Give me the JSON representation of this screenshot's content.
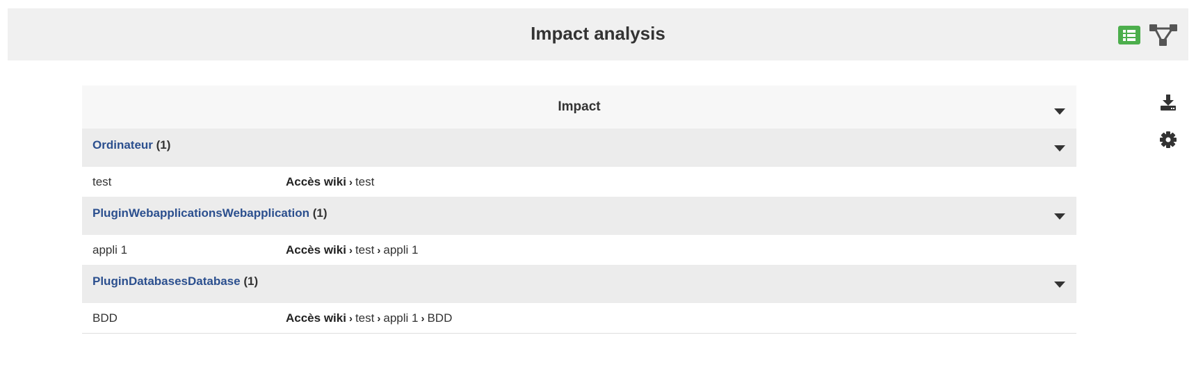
{
  "header": {
    "title": "Impact analysis",
    "list_view_icon": "list-view-icon",
    "graph_view_icon": "graph-view-icon",
    "list_view_color": "#4cae4c"
  },
  "side_actions": {
    "download_icon": "download-icon",
    "settings_icon": "gear-icon"
  },
  "impact": {
    "title": "Impact",
    "groups": [
      {
        "name": "Ordinateur",
        "count": "(1)",
        "items": [
          {
            "name": "test",
            "path_root": "Accès wiki",
            "path": [
              "test"
            ]
          }
        ]
      },
      {
        "name": "PluginWebapplicationsWebapplication",
        "count": "(1)",
        "items": [
          {
            "name": "appli 1",
            "path_root": "Accès wiki",
            "path": [
              "test",
              "appli 1"
            ]
          }
        ]
      },
      {
        "name": "PluginDatabasesDatabase",
        "count": "(1)",
        "items": [
          {
            "name": "BDD",
            "path_root": "Accès wiki",
            "path": [
              "test",
              "appli 1",
              "BDD"
            ]
          }
        ]
      }
    ]
  },
  "colors": {
    "link": "#2b4f8e",
    "header_bg": "#f0f0f0",
    "group_bg": "#ececec"
  }
}
